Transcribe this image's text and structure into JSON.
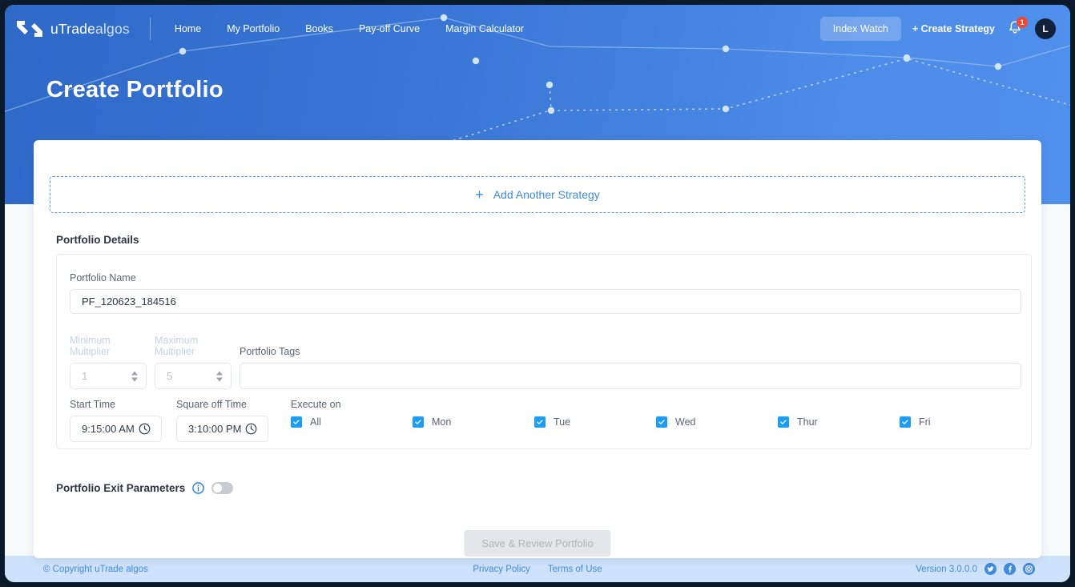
{
  "brand": {
    "name_bold": "uTrade",
    "name_light": "algos",
    "logo_icon": "utrade-logo-icon"
  },
  "nav": {
    "links": [
      {
        "label": "Home"
      },
      {
        "label": "My Portfolio"
      },
      {
        "label": "Books"
      },
      {
        "label": "Pay-off Curve"
      },
      {
        "label": "Margin Calculator"
      }
    ],
    "index_watch": "Index Watch",
    "create_strategy": "+ Create Strategy",
    "bell_icon": "notification-bell-icon",
    "notification_count": "1",
    "avatar_initial": "L"
  },
  "hero": {
    "title": "Create Portfolio"
  },
  "card": {
    "add_strategy": {
      "plus": "+",
      "label": "Add Another Strategy"
    },
    "section_title": "Portfolio Details",
    "portfolio_name": {
      "label": "Portfolio Name",
      "value": "PF_120623_184516"
    },
    "minimum_multiplier": {
      "label": "Minimum Multiplier",
      "value": "1"
    },
    "maximum_multiplier": {
      "label": "Maximum Multiplier",
      "value": "5"
    },
    "portfolio_tags": {
      "label": "Portfolio Tags",
      "value": "",
      "placeholder": ""
    },
    "start_time": {
      "label": "Start Time",
      "value": "9:15:00 AM",
      "icon": "clock-icon"
    },
    "square_off_time": {
      "label": "Square off Time",
      "value": "3:10:00 PM",
      "icon": "clock-icon"
    },
    "execute_on": {
      "label": "Execute on",
      "days": [
        {
          "label": "All",
          "checked": true
        },
        {
          "label": "Mon",
          "checked": true
        },
        {
          "label": "Tue",
          "checked": true
        },
        {
          "label": "Wed",
          "checked": true
        },
        {
          "label": "Thur",
          "checked": true
        },
        {
          "label": "Fri",
          "checked": true
        }
      ]
    },
    "exit_parameters": {
      "label": "Portfolio Exit Parameters",
      "info_icon": "info-icon",
      "toggle_on": false
    },
    "save_button": "Save & Review Portfolio"
  },
  "footer": {
    "copyright": "© Copyright uTrade algos",
    "privacy_policy": "Privacy Policy",
    "terms_of_use": "Terms of Use",
    "version": "Version 3.0.0.0",
    "social": [
      {
        "name": "twitter-icon"
      },
      {
        "name": "facebook-icon"
      },
      {
        "name": "instagram-icon"
      }
    ]
  },
  "colors": {
    "hero_blue": "#3a77d6",
    "accent_blue": "#3f8ae0",
    "checkbox_blue": "#1b9cf5",
    "badge_red": "#f4452e",
    "footer_blue": "#cfe2fb"
  }
}
